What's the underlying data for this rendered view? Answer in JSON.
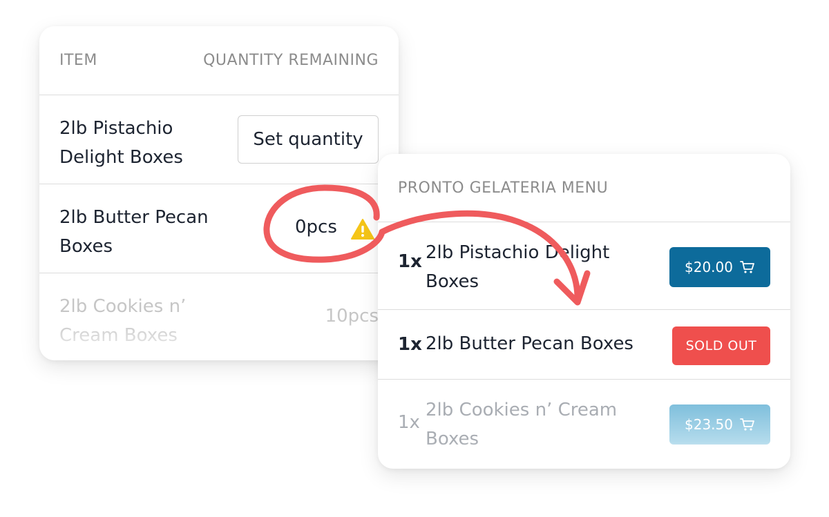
{
  "inventory": {
    "header_item": "ITEM",
    "header_qty": "QUANTITY REMAINING",
    "rows": [
      {
        "name": "2lb Pistachio Delight Boxes",
        "action_label": "Set quantity"
      },
      {
        "name": "2lb Butter Pecan Boxes",
        "qty": "0pcs",
        "warning_icon": "warning-triangle"
      },
      {
        "name": "2lb Cookies n’ Cream Boxes",
        "qty": "10pcs"
      }
    ]
  },
  "menu": {
    "title": "PRONTO GELATERIA MENU",
    "items": [
      {
        "qty": "1x",
        "name": "2lb Pistachio Delight Boxes",
        "price": "$20.00",
        "icon": "cart-icon"
      },
      {
        "qty": "1x",
        "name": "2lb Butter Pecan Boxes",
        "status": "SOLD OUT"
      },
      {
        "qty": "1x",
        "name": "2lb Cookies n’ Cream Boxes",
        "price": "$23.50",
        "icon": "cart-icon"
      }
    ]
  },
  "colors": {
    "price_button": "#0d6b9b",
    "sold_out": "#ef4f4d",
    "warning": "#f5c518",
    "annotation": "#ef5b5d"
  }
}
